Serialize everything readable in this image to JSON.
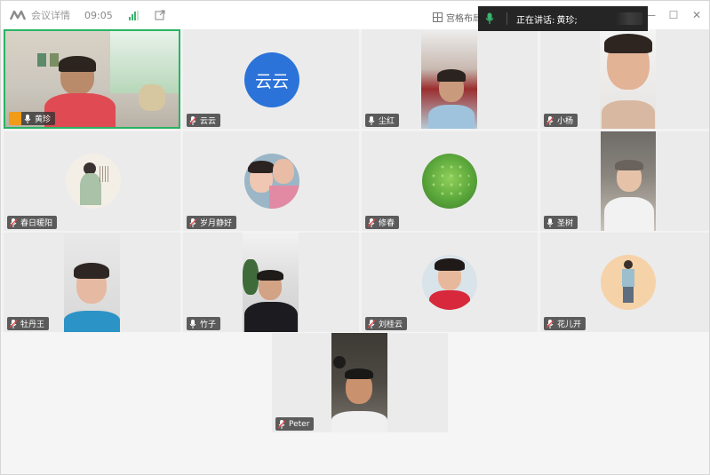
{
  "title_bar": {
    "meeting_details": "会议详情",
    "time": "09:05",
    "layout_label": "宫格布局",
    "speaking_prefix": "正在讲话:",
    "speaking_name": "黄珍;"
  },
  "colors": {
    "active_border": "#28b463",
    "host_badge": "#f29b16",
    "mic_green": "#3cb46e",
    "name_tag_bg": "#323232",
    "avatar_blue": "#2b73d9"
  },
  "participants": [
    {
      "name": "黄珍",
      "mic": "on",
      "host": true,
      "active": true
    },
    {
      "name": "云云",
      "mic": "muted",
      "avatar_text": "云云"
    },
    {
      "name": "尘红",
      "mic": "on"
    },
    {
      "name": "小杨",
      "mic": "muted"
    },
    {
      "name": "春日暖阳",
      "mic": "muted"
    },
    {
      "name": "岁月静好",
      "mic": "muted"
    },
    {
      "name": "修春",
      "mic": "muted"
    },
    {
      "name": "圣树",
      "mic": "on"
    },
    {
      "name": "牡丹王",
      "mic": "muted"
    },
    {
      "name": "竹子",
      "mic": "on"
    },
    {
      "name": "刘桂云",
      "mic": "muted"
    },
    {
      "name": "花儿开",
      "mic": "muted"
    },
    {
      "name": "Peter",
      "mic": "muted"
    }
  ]
}
